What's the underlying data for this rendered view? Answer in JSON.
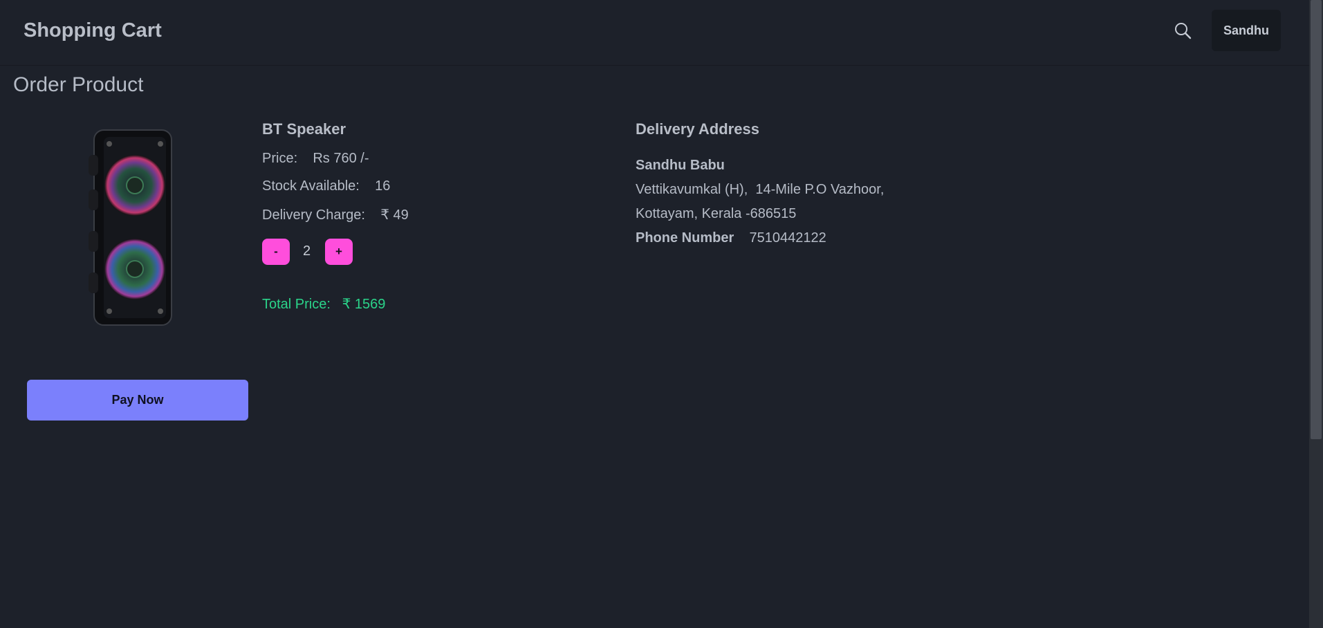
{
  "header": {
    "title": "Shopping Cart",
    "user_label": "Sandhu"
  },
  "page": {
    "title": "Order Product"
  },
  "product": {
    "name": "BT Speaker",
    "price_label": "Price:",
    "price_value": "Rs 760 /-",
    "stock_label": "Stock Available:",
    "stock_value": "16",
    "delivery_label": "Delivery Charge:",
    "delivery_value": "₹ 49",
    "minus_label": "-",
    "plus_label": "+",
    "quantity": "2",
    "total_label": "Total Price:",
    "total_value": "₹ 1569"
  },
  "actions": {
    "pay_label": "Pay Now"
  },
  "address": {
    "title": "Delivery Address",
    "name": "Sandhu Babu",
    "line1": "Vettikavumkal (H),  14-Mile P.O Vazhoor,",
    "line2": "Kottayam, Kerala -686515",
    "phone_label": "Phone Number",
    "phone_value": "7510442122"
  },
  "colors": {
    "background": "#1d212a",
    "accent_pay": "#7b80fc",
    "accent_qty": "#ff4edc",
    "total_green": "#2bd48a"
  },
  "icons": {
    "search": "search-icon"
  }
}
